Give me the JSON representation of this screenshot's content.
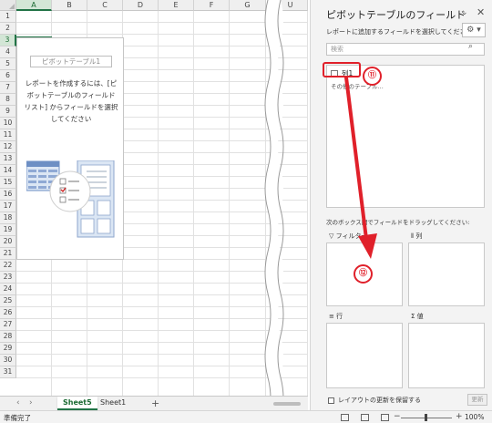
{
  "grid": {
    "columns": [
      "A",
      "B",
      "C",
      "D",
      "E",
      "F",
      "G",
      "U"
    ],
    "rows": [
      "1",
      "2",
      "3",
      "4",
      "5",
      "6",
      "7",
      "8",
      "9",
      "10",
      "11",
      "12",
      "13",
      "14",
      "15",
      "16",
      "17",
      "18",
      "19",
      "20",
      "21",
      "22",
      "23",
      "24",
      "25",
      "26",
      "27",
      "28",
      "29",
      "30",
      "31"
    ],
    "selected_column": "A",
    "selected_row": "3"
  },
  "pivot_placeholder": {
    "name": "ピボットテーブル1",
    "instruction_lines": [
      "レポートを作成するには、[ピ",
      "ボットテーブルのフィールド",
      "リスト] からフィールドを選択",
      "してください"
    ]
  },
  "sheet_tabs": {
    "prev": "‹",
    "next": "›",
    "tabs": [
      "Sheet5",
      "Sheet1"
    ],
    "active": "Sheet5",
    "add": "+"
  },
  "status": {
    "text": "準備完了",
    "zoom": "100%",
    "zoom_minus": "−",
    "zoom_plus": "+"
  },
  "pane": {
    "title": "ピボットテーブルのフィールド",
    "subtitle": "レポートに追加するフィールドを選択してください:",
    "search_placeholder": "検索",
    "fields": [
      {
        "label": "列1",
        "checked": false
      }
    ],
    "more_tables": "その他のテーブル...",
    "drag_hint": "次のボックス間でフィールドをドラッグしてください:",
    "areas": {
      "filter": "フィルター",
      "columns": "列",
      "rows": "行",
      "values": "値"
    },
    "defer_label": "レイアウトの更新を保留する",
    "update_button": "更新",
    "chevron": "⌄",
    "close": "✕",
    "settings": "⚙ ▾",
    "search_icon": "⌕"
  },
  "annotations": {
    "step_a": "⑪",
    "step_b": "⑫",
    "color": "#e0202a"
  },
  "colors": {
    "excel_green": "#217346",
    "pane_bg": "#f3f3f3",
    "annotation_red": "#e0202a"
  }
}
